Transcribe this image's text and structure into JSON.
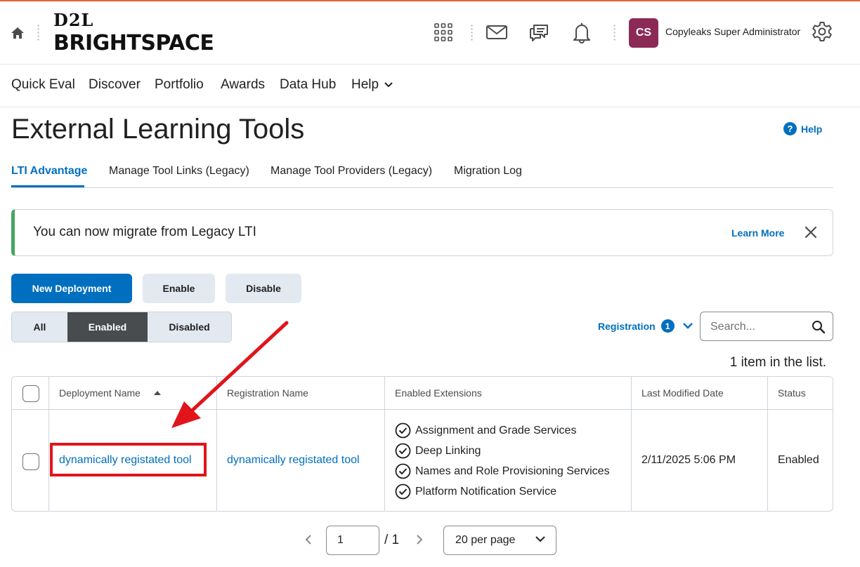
{
  "colors": {
    "accent": "#006fbf",
    "avatar_bg": "#8b2a57",
    "alert_bar": "#46a661",
    "annotation": "#e1141b",
    "active_segment": "#494c4e"
  },
  "header": {
    "logo_top": "D2L",
    "logo_bottom": "BRIGHTSPACE",
    "avatar_initials": "CS",
    "username": "Copyleaks Super Administrator",
    "icons": [
      "home-icon",
      "apps-grid-icon",
      "mail-icon",
      "chat-icon",
      "bell-icon",
      "gear-icon"
    ]
  },
  "nav": {
    "items": [
      "Quick Eval",
      "Discover",
      "Portfolio",
      "Awards",
      "Data Hub",
      "Help"
    ]
  },
  "page": {
    "title": "External Learning Tools",
    "help_label": "Help"
  },
  "tabs": [
    "LTI Advantage",
    "Manage Tool Links (Legacy)",
    "Manage Tool Providers (Legacy)",
    "Migration Log"
  ],
  "alert": {
    "text": "You can now migrate from Legacy LTI",
    "learn_more": "Learn More"
  },
  "actions": {
    "new_deployment": "New Deployment",
    "enable": "Enable",
    "disable": "Disable"
  },
  "filter": {
    "segments": [
      "All",
      "Enabled",
      "Disabled"
    ],
    "active_segment": "Enabled",
    "registration_label": "Registration",
    "registration_count": "1"
  },
  "search": {
    "placeholder": "Search..."
  },
  "list_count": "1 item in the list.",
  "table": {
    "headers": [
      "Deployment Name",
      "Registration Name",
      "Enabled Extensions",
      "Last Modified Date",
      "Status"
    ],
    "rows": [
      {
        "deployment_name": "dynamically registated tool",
        "registration_name": "dynamically registated tool",
        "extensions": [
          "Assignment and Grade Services",
          "Deep Linking",
          "Names and Role Provisioning Services",
          "Platform Notification Service"
        ],
        "last_modified": "2/11/2025 5:06 PM",
        "status": "Enabled"
      }
    ]
  },
  "pagination": {
    "page": "1",
    "total": "/ 1",
    "per_page": "20 per page"
  }
}
